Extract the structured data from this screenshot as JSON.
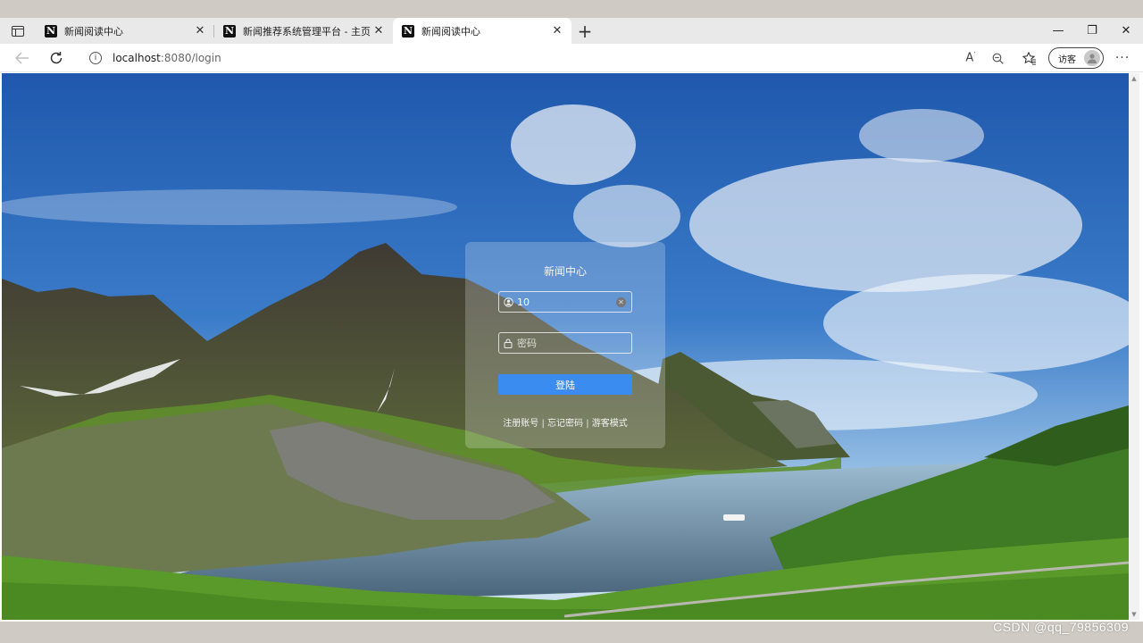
{
  "browser": {
    "tabs": [
      {
        "title": "新闻阅读中心",
        "active": false
      },
      {
        "title": "新闻推荐系统管理平台 - 主页",
        "active": false
      },
      {
        "title": "新闻阅读中心",
        "active": true
      }
    ],
    "favicon_letter": "N",
    "url_host": "localhost",
    "url_rest": ":8080/login",
    "guest_label": "访客"
  },
  "login": {
    "title": "新闻中心",
    "username_value": "10",
    "password_placeholder": "密码",
    "login_button": "登陆",
    "links": {
      "register": "注册账号",
      "forgot": "忘记密码",
      "guest_mode": "游客模式",
      "separator": "|"
    }
  },
  "watermark": "CSDN @qq_79856309",
  "colors": {
    "login_button": "#3b8cf0",
    "sky": "#2a66b8",
    "grass": "#5a9a2a"
  },
  "icons": [
    "sidebar-icon",
    "back-icon",
    "refresh-icon",
    "info-icon",
    "read-aloud-icon",
    "zoom-icon",
    "favorites-icon",
    "more-icon",
    "user-icon",
    "lock-icon",
    "clear-icon"
  ]
}
